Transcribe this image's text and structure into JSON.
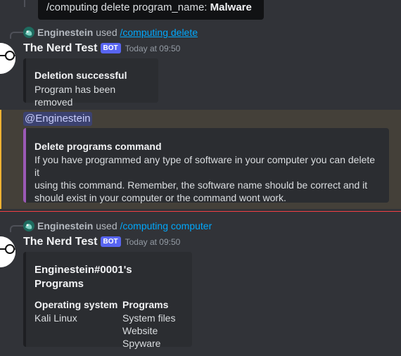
{
  "tooltip": {
    "prefix": "/computing delete program_name:",
    "value": "Malware"
  },
  "msg1": {
    "reply_user": "Enginestein",
    "reply_used": "used",
    "reply_command": "/computing delete",
    "author": "The Nerd Test",
    "badge": "BOT",
    "timestamp": "Today at 09:50",
    "embed": {
      "title": "Deletion successful",
      "description": "Program has been removed"
    }
  },
  "msg2": {
    "mention": "@Enginestein",
    "embed": {
      "title": "Delete programs command",
      "lines": [
        "If you have programmed any type of software in your computer you can delete it",
        "using this command. Remember, the software name should be correct and it",
        "should exist in your computer or the command wont work."
      ]
    }
  },
  "msg3": {
    "reply_user": "Enginestein",
    "reply_used": "used",
    "reply_command": "/computing computer",
    "author": "The Nerd Test",
    "badge": "BOT",
    "timestamp": "Today at 09:50",
    "embed": {
      "title": "Enginestein#0001's Programs",
      "fields": [
        {
          "name": "Operating system",
          "values": [
            "Kali Linux"
          ]
        },
        {
          "name": "Programs",
          "values": [
            "System files",
            "Website",
            "Spyware"
          ]
        }
      ]
    }
  },
  "colors": {
    "accent_purple": "#9b59b6",
    "mention_bar": "#f0b232",
    "new_divider": "#f23f43",
    "link": "#00a8fc"
  }
}
